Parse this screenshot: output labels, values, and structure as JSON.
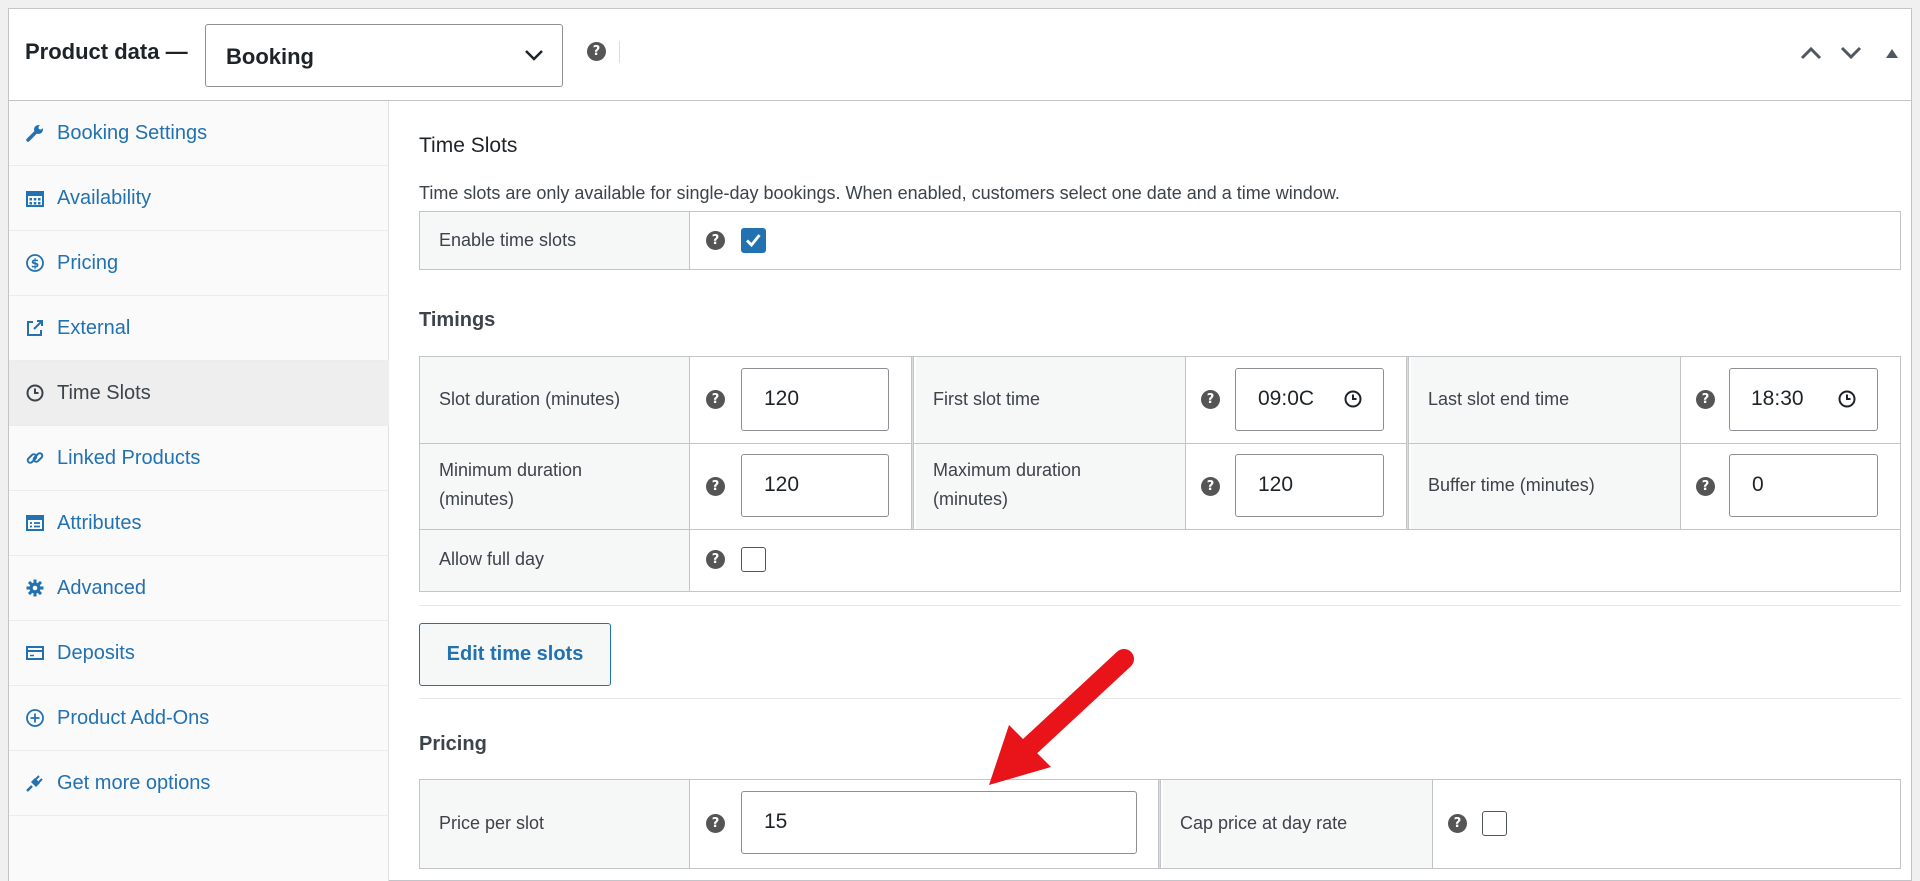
{
  "header": {
    "title": "Product data —",
    "product_type": "Booking"
  },
  "sidebar": {
    "items": [
      {
        "label": "Booking Settings",
        "icon": "wrench-icon"
      },
      {
        "label": "Availability",
        "icon": "calendar-icon"
      },
      {
        "label": "Pricing",
        "icon": "dollar-icon"
      },
      {
        "label": "External",
        "icon": "external-link-icon"
      },
      {
        "label": "Time Slots",
        "icon": "clock-icon"
      },
      {
        "label": "Linked Products",
        "icon": "link-icon"
      },
      {
        "label": "Attributes",
        "icon": "list-icon"
      },
      {
        "label": "Advanced",
        "icon": "gear-icon"
      },
      {
        "label": "Deposits",
        "icon": "card-icon"
      },
      {
        "label": "Product Add-Ons",
        "icon": "plus-circle-icon"
      },
      {
        "label": "Get more options",
        "icon": "plug-icon"
      }
    ],
    "active": "Time Slots"
  },
  "time_slots": {
    "title": "Time Slots",
    "description": "Time slots are only available for single-day bookings. When enabled, customers select one date and a time window.",
    "enable_label": "Enable time slots",
    "enable_checked": true
  },
  "timings": {
    "title": "Timings",
    "slot_duration_label": "Slot duration (minutes)",
    "slot_duration": "120",
    "first_slot_label": "First slot time",
    "first_slot": "09:0C",
    "last_slot_label": "Last slot end time",
    "last_slot": "18:30",
    "min_duration_label_1": "Minimum duration",
    "min_duration_label_2": "(minutes)",
    "min_duration": "120",
    "max_duration_label_1": "Maximum duration",
    "max_duration_label_2": "(minutes)",
    "max_duration": "120",
    "buffer_label": "Buffer time (minutes)",
    "buffer": "0",
    "full_day_label": "Allow full day",
    "full_day_checked": false
  },
  "edit_button": "Edit time slots",
  "pricing": {
    "title": "Pricing",
    "price_label": "Price per slot",
    "price": "15",
    "cap_label": "Cap price at day rate",
    "cap_checked": false
  },
  "help_glyph": "?",
  "colors": {
    "link": "#2271b1",
    "arrow": "#e8141a",
    "checkbox_on": "#2271b1"
  }
}
